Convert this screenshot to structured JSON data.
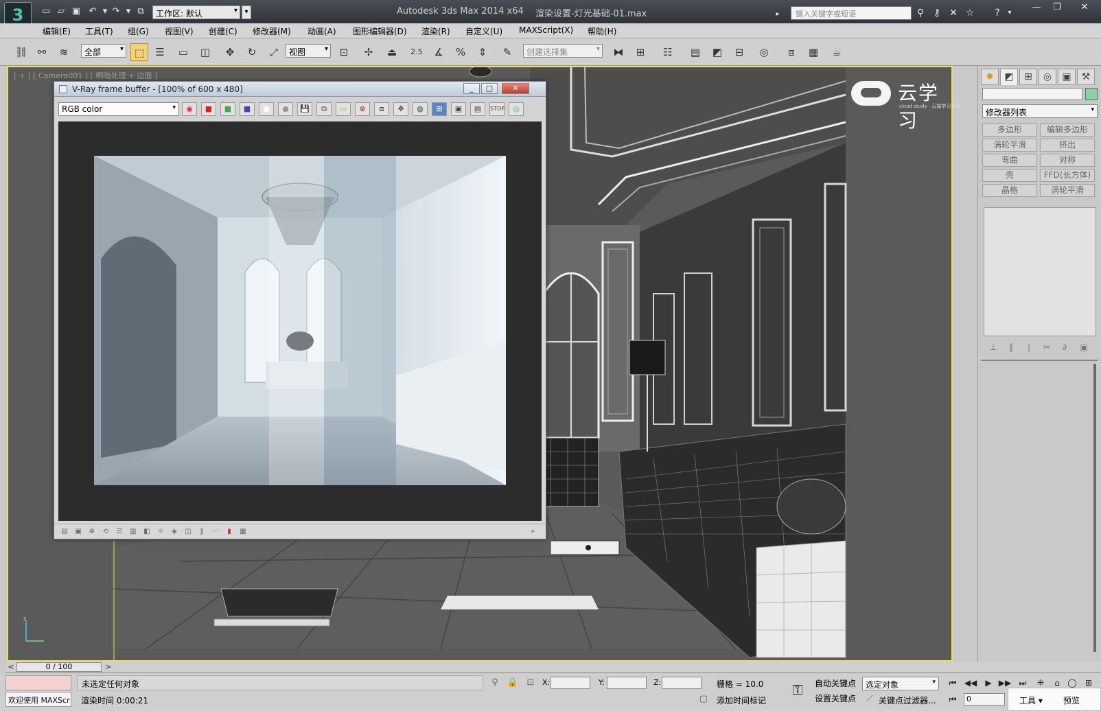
{
  "titlebar": {
    "app_title": "Autodesk 3ds Max  2014 x64",
    "doc_title": "渲染设置-灯光基础-01.max",
    "workspace": "工作区: 默认",
    "search_placeholder": "键入关键字或短语"
  },
  "menu": {
    "items": [
      "编辑(E)",
      "工具(T)",
      "组(G)",
      "视图(V)",
      "创建(C)",
      "修改器(M)",
      "动画(A)",
      "图形编辑器(D)",
      "渲染(R)",
      "自定义(U)",
      "MAXScript(X)",
      "帮助(H)"
    ]
  },
  "toolbar": {
    "selection_filter": "全部",
    "ref_coord": "视图",
    "named_selection_placeholder": "创建选择集",
    "snap_label": "2.5"
  },
  "viewport": {
    "label": "[ + ] [ Camera001 ] [ 明暗处理 + 边面 ]",
    "brand_text": "云学习",
    "brand_sub": "cloud study · 云端学习平台",
    "highlight_color": "#e8e35a"
  },
  "vfb": {
    "title": "V-Ray frame buffer - [100% of 600 x 480]",
    "channel": "RGB color"
  },
  "cmdpanel": {
    "modifier_list": "修改器列表",
    "buttons": [
      "多边形",
      "编辑多边形",
      "涡轮平滑",
      "挤出",
      "弯曲",
      "对称",
      "壳",
      "FFD(长方体)",
      "晶格",
      "涡轮平滑"
    ]
  },
  "timeline": {
    "frame_display": "0 / 100",
    "prev": "<",
    "next": ">"
  },
  "status": {
    "welcome": "欢迎使用 MAXScr",
    "selection": "未选定任何对象",
    "render_time": "渲染时间  0:00:21",
    "x_label": "X:",
    "y_label": "Y:",
    "z_label": "Z:",
    "grid": "栅格 = 10.0",
    "add_time_tag": "添加时间标记",
    "auto_key": "自动关键点",
    "set_key": "设置关键点",
    "key_mode": "选定对象",
    "key_filters": "关键点过滤器...",
    "current_frame": "0",
    "popup_tools": "工具 ▾",
    "popup_preview": "预览"
  }
}
